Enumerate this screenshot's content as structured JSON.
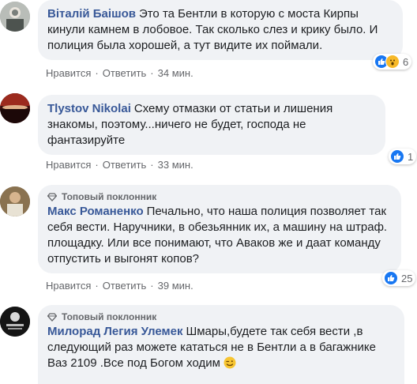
{
  "badge_label": "Топовый поклонник",
  "comments": [
    {
      "author": "Віталій Баішов",
      "text": "Это та Бентли в которую с моста Кирпы кинули камнем в лобовое. Так сколько слез и крику было. И полиция была хорошей, а тут видите их поймали.",
      "like_label": "Нравится",
      "reply_label": "Ответить",
      "time": "34 мин.",
      "reactions": [
        "like-icon",
        "wow-icon"
      ],
      "reaction_count": "6"
    },
    {
      "author": "Tlystov Nikolai",
      "text": "Схему отмазки от статьи и лишения знакомы, поэтому...ничего не будет, господа не фантазируйте",
      "like_label": "Нравится",
      "reply_label": "Ответить",
      "time": "33 мин.",
      "reactions": [
        "like-icon"
      ],
      "reaction_count": "1"
    },
    {
      "author": "Макс Романенко",
      "text": "Печально, что наша полиция позволяет так себя вести. Наручники, в обезьянник их, а машину на штраф. площадку. Или все понимают, что Аваков же и даат команду отпустить и выгонят копов?",
      "like_label": "Нравится",
      "reply_label": "Ответить",
      "time": "39 мин.",
      "reactions": [
        "like-icon"
      ],
      "reaction_count": "25"
    },
    {
      "author": "Милорад Легия Улемек",
      "text": "Шмары,будете так себя вести ,в следующий раз можете кататься не в Бентли а в багажнике Ваз 2109 .Все под Богом ходим",
      "reactions": []
    }
  ],
  "colors": {
    "link": "#385898",
    "bubble": "#f0f2f5",
    "muted": "#65676b",
    "like": "#1877f2"
  }
}
